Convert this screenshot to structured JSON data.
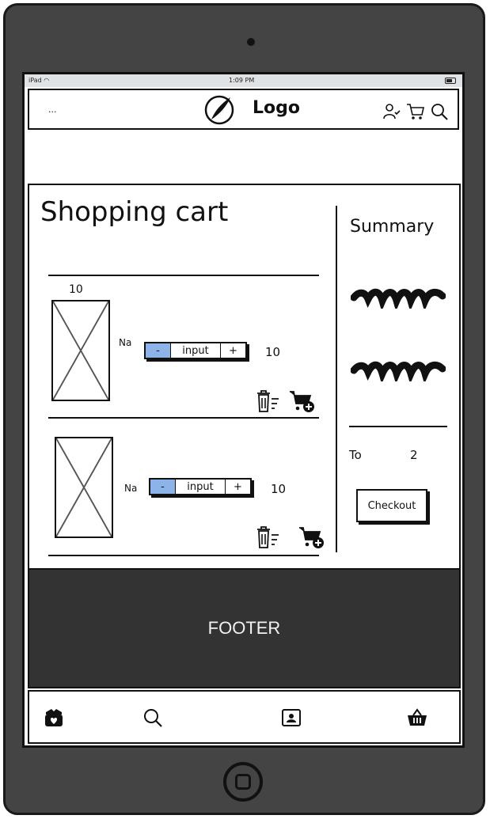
{
  "status_bar": {
    "device": "iPad",
    "time": "1:09 PM"
  },
  "header": {
    "menu_text": "...",
    "logo_text": "Logo",
    "logo_icon": "compass-icon",
    "icons": [
      "user-check-icon",
      "cart-icon",
      "search-icon"
    ]
  },
  "cart": {
    "title": "Shopping cart",
    "items": [
      {
        "quantity_label": "10",
        "name": "Na",
        "minus_label": "-",
        "input_label": "input",
        "plus_label": "+",
        "price": "10"
      },
      {
        "quantity_label": "",
        "name": "Na",
        "minus_label": "-",
        "input_label": "input",
        "plus_label": "+",
        "price": "10"
      }
    ]
  },
  "summary": {
    "title": "Summary",
    "total_label": "To",
    "total_value": "2",
    "checkout_label": "Checkout"
  },
  "footer": {
    "label": "FOOTER"
  },
  "tabbar": {
    "icons": [
      "gift-heart-icon",
      "search-icon",
      "profile-card-icon",
      "basket-icon"
    ]
  },
  "colors": {
    "device": "#444444",
    "footer": "#333333",
    "stepper_minus": "#8cb4e8",
    "statusbar": "#dfe3e6"
  }
}
